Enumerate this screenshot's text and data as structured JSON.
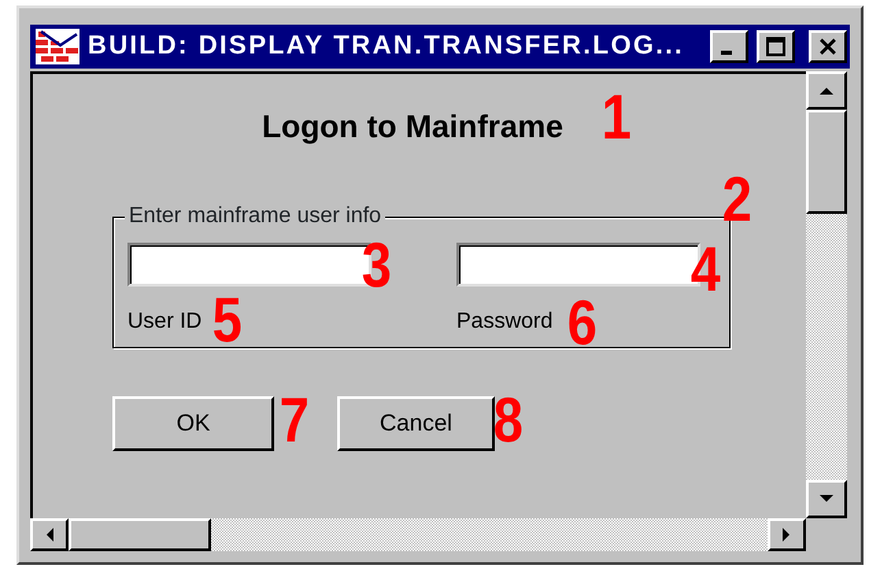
{
  "window": {
    "title": "BUILD: DISPLAY TRAN.TRANSFER.LOG..."
  },
  "heading": "Logon to Mainframe",
  "group": {
    "legend": "Enter mainframe user info",
    "fields": [
      {
        "label": "User ID"
      },
      {
        "label": "Password"
      }
    ]
  },
  "buttons": [
    "OK",
    "Cancel"
  ],
  "callouts": [
    "1",
    "2",
    "3",
    "4",
    "5",
    "6",
    "7",
    "8"
  ]
}
